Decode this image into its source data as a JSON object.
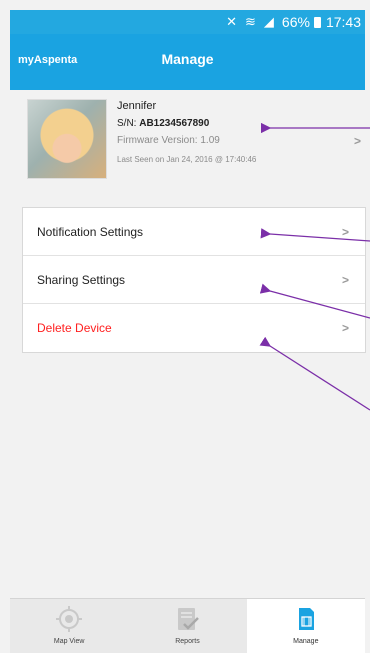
{
  "status_bar": {
    "battery": "66%",
    "time": "17:43",
    "icons": [
      "mute-icon",
      "wifi-icon",
      "signal-icon",
      "battery-icon"
    ]
  },
  "app_bar": {
    "brand": "myAspenta",
    "title": "Manage"
  },
  "device": {
    "name": "Jennifer",
    "sn_label": "S/N: ",
    "sn_value": "AB1234567890",
    "firmware": "Firmware Version: 1.09",
    "last_seen": "Last Seen on Jan 24, 2016 @ 17:40:46"
  },
  "menu": {
    "items": [
      {
        "label": "Notification Settings"
      },
      {
        "label": "Sharing Settings"
      },
      {
        "label": "Delete Device"
      }
    ]
  },
  "tabs": [
    {
      "label": "Map View",
      "icon": "crosshair-icon"
    },
    {
      "label": "Reports",
      "icon": "report-icon"
    },
    {
      "label": "Manage",
      "icon": "sim-card-icon"
    }
  ],
  "colors": {
    "accent": "#1aa3e1",
    "danger": "#ff2020",
    "annotation": "#7b2fa8"
  }
}
